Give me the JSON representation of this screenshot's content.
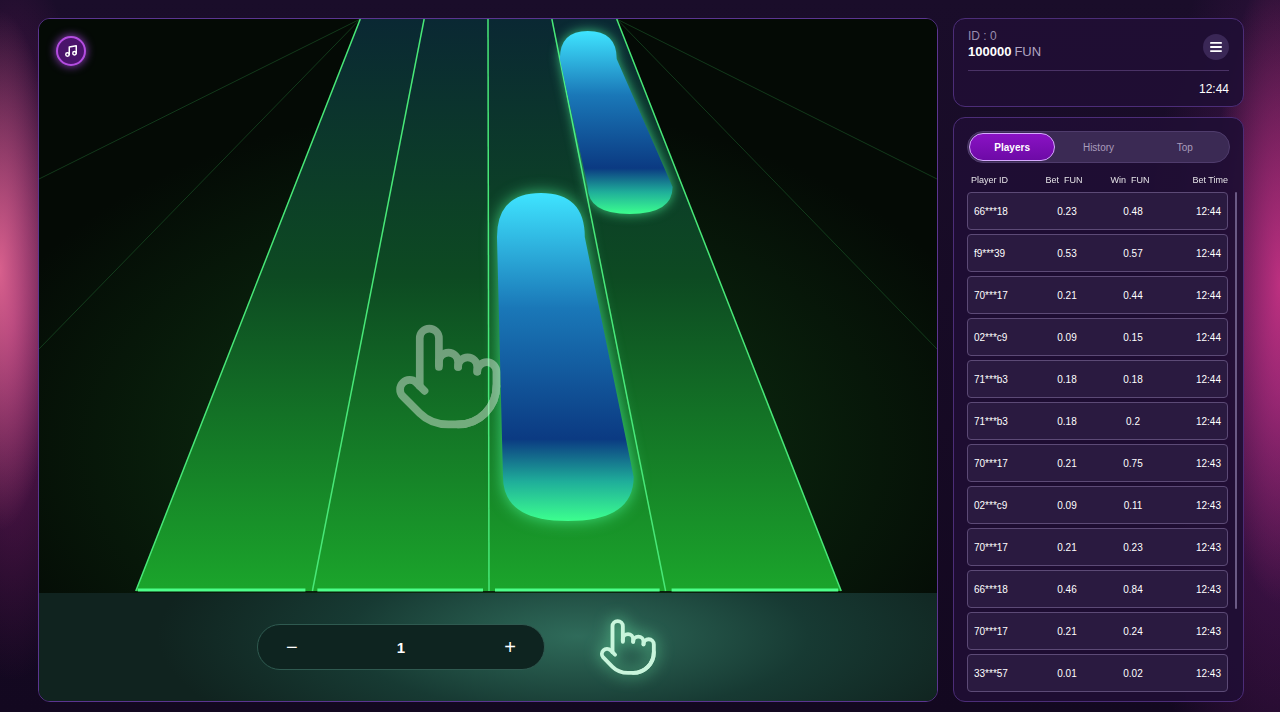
{
  "account": {
    "id": "ID : 0",
    "balance": "100000",
    "currency": "FUN",
    "time": "12:44"
  },
  "bet": {
    "decrement": "−",
    "value": "1",
    "increment": "+"
  },
  "tabs": [
    {
      "label": "Players",
      "selected": true
    },
    {
      "label": "History",
      "selected": false
    },
    {
      "label": "Top",
      "selected": false
    }
  ],
  "table": {
    "columns": [
      "Player ID",
      "Bet  FUN",
      "Win  FUN",
      "Bet Time"
    ],
    "rows": [
      [
        "66***18",
        "0.23",
        "0.48",
        "12:44"
      ],
      [
        "f9***39",
        "0.53",
        "0.57",
        "12:44"
      ],
      [
        "70***17",
        "0.21",
        "0.44",
        "12:44"
      ],
      [
        "02***c9",
        "0.09",
        "0.15",
        "12:44"
      ],
      [
        "71***b3",
        "0.18",
        "0.18",
        "12:44"
      ],
      [
        "71***b3",
        "0.18",
        "0.2",
        "12:44"
      ],
      [
        "70***17",
        "0.21",
        "0.75",
        "12:43"
      ],
      [
        "02***c9",
        "0.09",
        "0.11",
        "12:43"
      ],
      [
        "70***17",
        "0.21",
        "0.23",
        "12:43"
      ],
      [
        "66***18",
        "0.46",
        "0.84",
        "12:43"
      ],
      [
        "70***17",
        "0.21",
        "0.24",
        "12:43"
      ],
      [
        "33***57",
        "0.01",
        "0.02",
        "12:43"
      ]
    ]
  },
  "scrollbar": {
    "level": 0.82
  }
}
